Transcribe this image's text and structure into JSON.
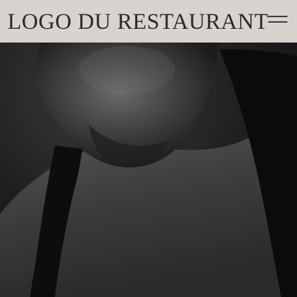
{
  "header": {
    "logo_text": "LOGO DU RESTAURANT",
    "menu_icon": "hamburger-menu-icon",
    "background": "#d7d3cf"
  },
  "hero": {
    "image": "chef-portrait-dark"
  }
}
